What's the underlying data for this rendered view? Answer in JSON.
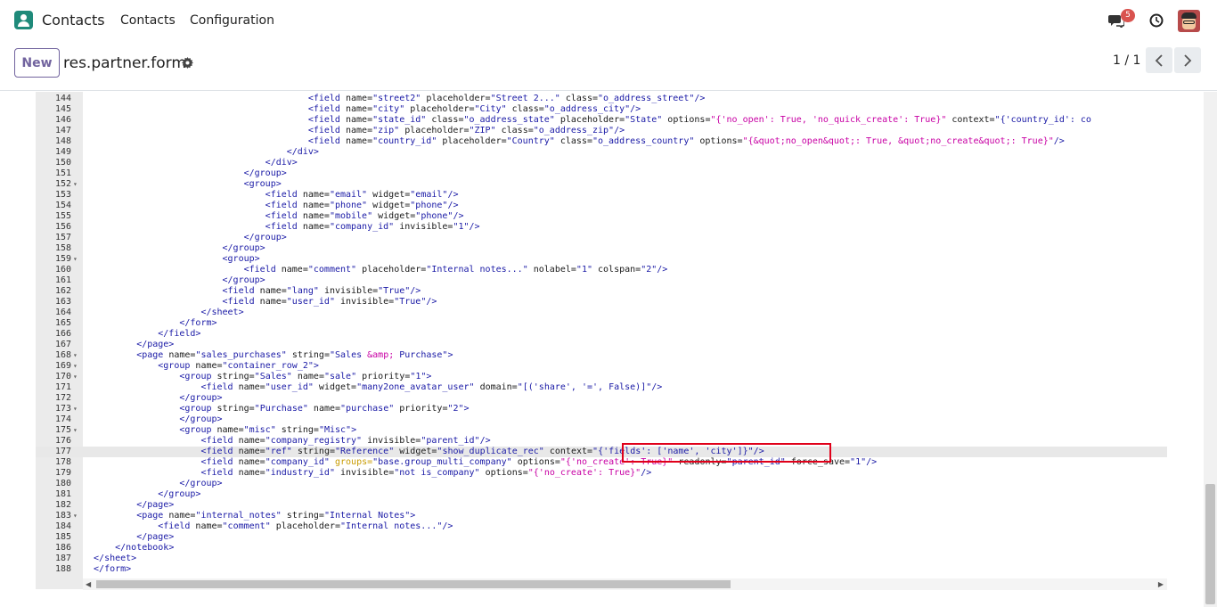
{
  "navbar": {
    "app_title": "Contacts",
    "menu": [
      "Contacts",
      "Configuration"
    ],
    "notification_count": "5"
  },
  "control": {
    "new_label": "New",
    "breadcrumb": "res.partner.form",
    "pager": "1 / 1"
  },
  "editor": {
    "lines": [
      {
        "n": "144",
        "fold": "",
        "indent": 42,
        "html": "<span class='tag'>&lt;field</span> <span class='attr'>name=</span><span class='str'>\"street2\"</span> <span class='attr'>placeholder=</span><span class='str'>\"Street 2...\"</span> <span class='attr'>class=</span><span class='str'>\"o_address_street\"</span><span class='tag'>/&gt;</span>"
      },
      {
        "n": "145",
        "fold": "",
        "indent": 42,
        "html": "<span class='tag'>&lt;field</span> <span class='attr'>name=</span><span class='str'>\"city\"</span> <span class='attr'>placeholder=</span><span class='str'>\"City\"</span> <span class='attr'>class=</span><span class='str'>\"o_address_city\"</span><span class='tag'>/&gt;</span>"
      },
      {
        "n": "146",
        "fold": "",
        "indent": 42,
        "html": "<span class='tag'>&lt;field</span> <span class='attr'>name=</span><span class='str'>\"state_id\"</span> <span class='attr'>class=</span><span class='str'>\"o_address_state\"</span> <span class='attr'>placeholder=</span><span class='str'>\"State\"</span> <span class='attr'>options=</span><span class='str-alt'>\"{'no_open': True, 'no_quick_create': True}\"</span> <span class='attr'>context=</span><span class='str'>\"{'country_id': co</span>"
      },
      {
        "n": "147",
        "fold": "",
        "indent": 42,
        "html": "<span class='tag'>&lt;field</span> <span class='attr'>name=</span><span class='str'>\"zip\"</span> <span class='attr'>placeholder=</span><span class='str'>\"ZIP\"</span> <span class='attr'>class=</span><span class='str'>\"o_address_zip\"</span><span class='tag'>/&gt;</span>"
      },
      {
        "n": "148",
        "fold": "",
        "indent": 42,
        "html": "<span class='tag'>&lt;field</span> <span class='attr'>name=</span><span class='str'>\"country_id\"</span> <span class='attr'>placeholder=</span><span class='str'>\"Country\"</span> <span class='attr'>class=</span><span class='str'>\"o_address_country\"</span> <span class='attr'>options=</span><span class='str-alt'>\"{&amp;quot;no_open&amp;quot;: True, &amp;quot;no_create&amp;quot;: True}\"</span><span class='tag'>/&gt;</span>"
      },
      {
        "n": "149",
        "fold": "",
        "indent": 38,
        "html": "<span class='tag'>&lt;/div&gt;</span>"
      },
      {
        "n": "150",
        "fold": "",
        "indent": 34,
        "html": "<span class='tag'>&lt;/div&gt;</span>"
      },
      {
        "n": "151",
        "fold": "",
        "indent": 30,
        "html": "<span class='tag'>&lt;/group&gt;</span>"
      },
      {
        "n": "152",
        "fold": "▾",
        "indent": 30,
        "html": "<span class='tag'>&lt;group&gt;</span>"
      },
      {
        "n": "153",
        "fold": "",
        "indent": 34,
        "html": "<span class='tag'>&lt;field</span> <span class='attr'>name=</span><span class='str'>\"email\"</span> <span class='attr'>widget=</span><span class='str'>\"email\"</span><span class='tag'>/&gt;</span>"
      },
      {
        "n": "154",
        "fold": "",
        "indent": 34,
        "html": "<span class='tag'>&lt;field</span> <span class='attr'>name=</span><span class='str'>\"phone\"</span> <span class='attr'>widget=</span><span class='str'>\"phone\"</span><span class='tag'>/&gt;</span>"
      },
      {
        "n": "155",
        "fold": "",
        "indent": 34,
        "html": "<span class='tag'>&lt;field</span> <span class='attr'>name=</span><span class='str'>\"mobile\"</span> <span class='attr'>widget=</span><span class='str'>\"phone\"</span><span class='tag'>/&gt;</span>"
      },
      {
        "n": "156",
        "fold": "",
        "indent": 34,
        "html": "<span class='tag'>&lt;field</span> <span class='attr'>name=</span><span class='str'>\"company_id\"</span> <span class='attr'>invisible=</span><span class='str'>\"1\"</span><span class='tag'>/&gt;</span>"
      },
      {
        "n": "157",
        "fold": "",
        "indent": 30,
        "html": "<span class='tag'>&lt;/group&gt;</span>"
      },
      {
        "n": "158",
        "fold": "",
        "indent": 26,
        "html": "<span class='tag'>&lt;/group&gt;</span>"
      },
      {
        "n": "159",
        "fold": "▾",
        "indent": 26,
        "html": "<span class='tag'>&lt;group&gt;</span>"
      },
      {
        "n": "160",
        "fold": "",
        "indent": 30,
        "html": "<span class='tag'>&lt;field</span> <span class='attr'>name=</span><span class='str'>\"comment\"</span> <span class='attr'>placeholder=</span><span class='str'>\"Internal notes...\"</span> <span class='attr'>nolabel=</span><span class='str'>\"1\"</span> <span class='attr'>colspan=</span><span class='str'>\"2\"</span><span class='tag'>/&gt;</span>"
      },
      {
        "n": "161",
        "fold": "",
        "indent": 26,
        "html": "<span class='tag'>&lt;/group&gt;</span>"
      },
      {
        "n": "162",
        "fold": "",
        "indent": 26,
        "html": "<span class='tag'>&lt;field</span> <span class='attr'>name=</span><span class='str'>\"lang\"</span> <span class='attr'>invisible=</span><span class='str'>\"True\"</span><span class='tag'>/&gt;</span>"
      },
      {
        "n": "163",
        "fold": "",
        "indent": 26,
        "html": "<span class='tag'>&lt;field</span> <span class='attr'>name=</span><span class='str'>\"user_id\"</span> <span class='attr'>invisible=</span><span class='str'>\"True\"</span><span class='tag'>/&gt;</span>"
      },
      {
        "n": "164",
        "fold": "",
        "indent": 22,
        "html": "<span class='tag'>&lt;/sheet&gt;</span>"
      },
      {
        "n": "165",
        "fold": "",
        "indent": 18,
        "html": "<span class='tag'>&lt;/form&gt;</span>"
      },
      {
        "n": "166",
        "fold": "",
        "indent": 14,
        "html": "<span class='tag'>&lt;/field&gt;</span>"
      },
      {
        "n": "167",
        "fold": "",
        "indent": 10,
        "html": "<span class='tag'>&lt;/page&gt;</span>"
      },
      {
        "n": "168",
        "fold": "▾",
        "indent": 10,
        "html": "<span class='tag'>&lt;page</span> <span class='attr'>name=</span><span class='str'>\"sales_purchases\"</span> <span class='attr'>string=</span><span class='str'>\"Sales </span><span class='str-alt'>&amp;amp;</span><span class='str'> Purchase\"</span><span class='tag'>&gt;</span>"
      },
      {
        "n": "169",
        "fold": "▾",
        "indent": 14,
        "html": "<span class='tag'>&lt;group</span> <span class='attr'>name=</span><span class='str'>\"container_row_2\"</span><span class='tag'>&gt;</span>"
      },
      {
        "n": "170",
        "fold": "▾",
        "indent": 18,
        "html": "<span class='tag'>&lt;group</span> <span class='attr'>string=</span><span class='str'>\"Sales\"</span> <span class='attr'>name=</span><span class='str'>\"sale\"</span> <span class='attr'>priority=</span><span class='str'>\"1\"</span><span class='tag'>&gt;</span>"
      },
      {
        "n": "171",
        "fold": "",
        "indent": 22,
        "html": "<span class='tag'>&lt;field</span> <span class='attr'>name=</span><span class='str'>\"user_id\"</span> <span class='attr'>widget=</span><span class='str'>\"many2one_avatar_user\"</span> <span class='attr'>domain=</span><span class='str'>\"[('share', '=', False)]\"</span><span class='tag'>/&gt;</span>"
      },
      {
        "n": "172",
        "fold": "",
        "indent": 18,
        "html": "<span class='tag'>&lt;/group&gt;</span>"
      },
      {
        "n": "173",
        "fold": "▾",
        "indent": 18,
        "html": "<span class='tag'>&lt;group</span> <span class='attr'>string=</span><span class='str'>\"Purchase\"</span> <span class='attr'>name=</span><span class='str'>\"purchase\"</span> <span class='attr'>priority=</span><span class='str'>\"2\"</span><span class='tag'>&gt;</span>"
      },
      {
        "n": "174",
        "fold": "",
        "indent": 18,
        "html": "<span class='tag'>&lt;/group&gt;</span>"
      },
      {
        "n": "175",
        "fold": "▾",
        "indent": 18,
        "html": "<span class='tag'>&lt;group</span> <span class='attr'>name=</span><span class='str'>\"misc\"</span> <span class='attr'>string=</span><span class='str'>\"Misc\"</span><span class='tag'>&gt;</span>"
      },
      {
        "n": "176",
        "fold": "",
        "indent": 22,
        "html": "<span class='tag'>&lt;field</span> <span class='attr'>name=</span><span class='str'>\"company_registry\"</span> <span class='attr'>invisible=</span><span class='str'>\"parent_id\"</span><span class='tag'>/&gt;</span>"
      },
      {
        "n": "177",
        "fold": "",
        "indent": 22,
        "active": true,
        "html": "<span class='tag'>&lt;field</span> <span class='attr'>name=</span><span class='str'>\"ref\"</span> <span class='attr'>string=</span><span class='str'>\"Reference\"</span> <span class='attr'>widget=</span><span class='str'>\"show_duplicate_rec\"</span> <span class='attr'>context=</span><span class='str'>\"{'fields': ['name', 'city']}\"</span><span class='tag'>/&gt;</span>"
      },
      {
        "n": "178",
        "fold": "",
        "indent": 22,
        "html": "<span class='tag'>&lt;field</span> <span class='attr'>name=</span><span class='str'>\"company_id\"</span> <span class='grp'>groups=</span><span class='str'>\"base.group_multi_company\"</span> <span class='attr'>options=</span><span class='str-alt'>\"{'no_create': True}\"</span> <span class='attr'>readonly=</span><span class='str'>\"parent_id\"</span> <span class='attr'>force_save=</span><span class='str'>\"1\"</span><span class='tag'>/&gt;</span>"
      },
      {
        "n": "179",
        "fold": "",
        "indent": 22,
        "html": "<span class='tag'>&lt;field</span> <span class='attr'>name=</span><span class='str'>\"industry_id\"</span> <span class='attr'>invisible=</span><span class='str'>\"not is_company\"</span> <span class='attr'>options=</span><span class='str-alt'>\"{'no_create': True}\"</span><span class='tag'>/&gt;</span>"
      },
      {
        "n": "180",
        "fold": "",
        "indent": 18,
        "html": "<span class='tag'>&lt;/group&gt;</span>"
      },
      {
        "n": "181",
        "fold": "",
        "indent": 14,
        "html": "<span class='tag'>&lt;/group&gt;</span>"
      },
      {
        "n": "182",
        "fold": "",
        "indent": 10,
        "html": "<span class='tag'>&lt;/page&gt;</span>"
      },
      {
        "n": "183",
        "fold": "▾",
        "indent": 10,
        "html": "<span class='tag'>&lt;page</span> <span class='attr'>name=</span><span class='str'>\"internal_notes\"</span> <span class='attr'>string=</span><span class='str'>\"Internal Notes\"</span><span class='tag'>&gt;</span>"
      },
      {
        "n": "184",
        "fold": "",
        "indent": 14,
        "html": "<span class='tag'>&lt;field</span> <span class='attr'>name=</span><span class='str'>\"comment\"</span> <span class='attr'>placeholder=</span><span class='str'>\"Internal notes...\"</span><span class='tag'>/&gt;</span>"
      },
      {
        "n": "185",
        "fold": "",
        "indent": 10,
        "html": "<span class='tag'>&lt;/page&gt;</span>"
      },
      {
        "n": "186",
        "fold": "",
        "indent": 6,
        "html": "<span class='tag'>&lt;/notebook&gt;</span>"
      },
      {
        "n": "187",
        "fold": "",
        "indent": 2,
        "html": "<span class='tag'>&lt;/sheet&gt;</span>"
      },
      {
        "n": "188",
        "fold": "",
        "indent": 2,
        "html": "<span class='tag'>&lt;/form&gt;</span>"
      }
    ]
  }
}
